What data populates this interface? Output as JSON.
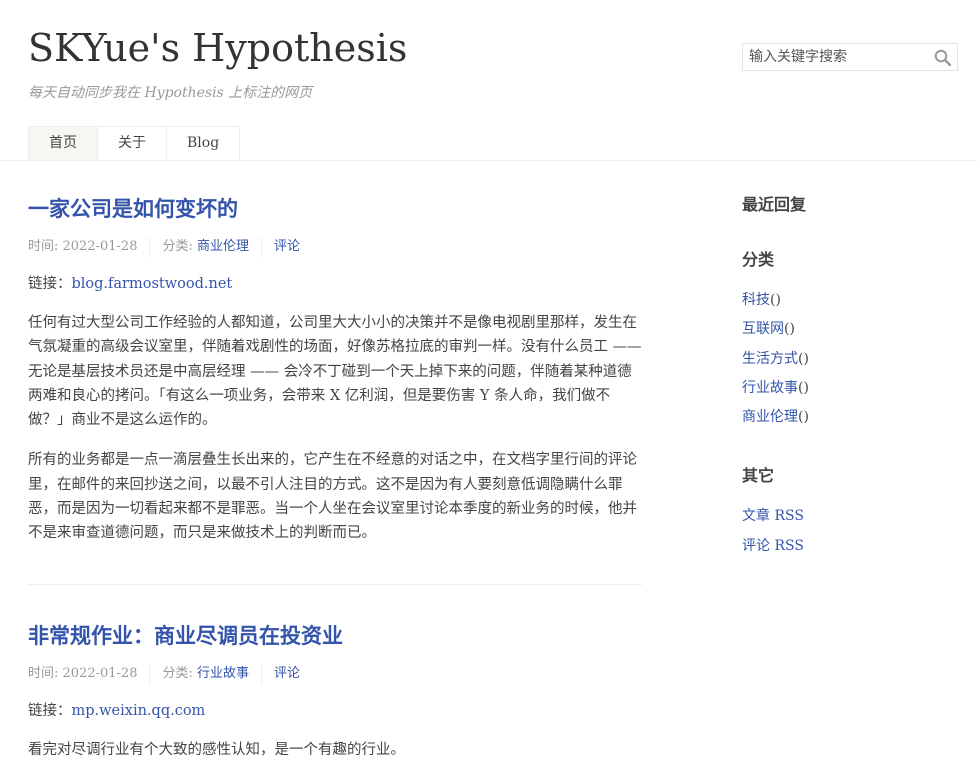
{
  "site": {
    "title": "SKYue's Hypothesis",
    "description": "每天自动同步我在 Hypothesis 上标注的网页"
  },
  "search": {
    "placeholder": "输入关键字搜索"
  },
  "nav": [
    {
      "label": "首页",
      "current": true
    },
    {
      "label": "关于",
      "current": false
    },
    {
      "label": "Blog",
      "current": false
    }
  ],
  "posts": [
    {
      "title": "一家公司是如何变坏的",
      "meta": {
        "time": "时间: 2022-01-28",
        "category_label": "分类:",
        "category": "商业伦理",
        "comments": "评论"
      },
      "link_label": "链接：",
      "link_text": "blog.farmostwood.net",
      "paragraphs": [
        "任何有过大型公司工作经验的人都知道，公司里大大小小的决策并不是像电视剧里那样，发生在气氛凝重的高级会议室里，伴随着戏剧性的场面，好像苏格拉底的审判一样。没有什么员工 —— 无论是基层技术员还是中高层经理 —— 会冷不丁碰到一个天上掉下来的问题，伴随着某种道德两难和良心的拷问。「有这么一项业务，会带来 X 亿利润，但是要伤害 Y 条人命，我们做不做？」商业不是这么运作的。",
        "所有的业务都是一点一滴层叠生长出来的，它产生在不经意的对话之中，在文档字里行间的评论里，在邮件的来回抄送之间，以最不引人注目的方式。这不是因为有人要刻意低调隐瞒什么罪恶，而是因为一切看起来都不是罪恶。当一个人坐在会议室里讨论本季度的新业务的时候，他并不是来审查道德问题，而只是来做技术上的判断而已。"
      ]
    },
    {
      "title": "非常规作业：商业尽调员在投资业",
      "meta": {
        "time": "时间: 2022-01-28",
        "category_label": "分类:",
        "category": "行业故事",
        "comments": "评论"
      },
      "link_label": "链接：",
      "link_text": "mp.weixin.qq.com",
      "paragraphs": [
        "看完对尽调行业有个大致的感性认知，是一个有趣的行业。"
      ]
    }
  ],
  "sidebar": {
    "recent": {
      "title": "最近回复"
    },
    "categories": {
      "title": "分类",
      "items": [
        {
          "label": "科技",
          "suffix": "()"
        },
        {
          "label": "互联网",
          "suffix": "()"
        },
        {
          "label": "生活方式",
          "suffix": "()"
        },
        {
          "label": "行业故事",
          "suffix": "()"
        },
        {
          "label": "商业伦理",
          "suffix": "()"
        }
      ]
    },
    "other": {
      "title": "其它",
      "items": [
        {
          "label": "文章 RSS"
        },
        {
          "label": "评论 RSS"
        }
      ]
    }
  },
  "colors": {
    "link": "#3354AA",
    "text": "#444444",
    "muted": "#999999",
    "border": "#eeeeee"
  },
  "icons": {
    "search": "magnifier-icon"
  }
}
